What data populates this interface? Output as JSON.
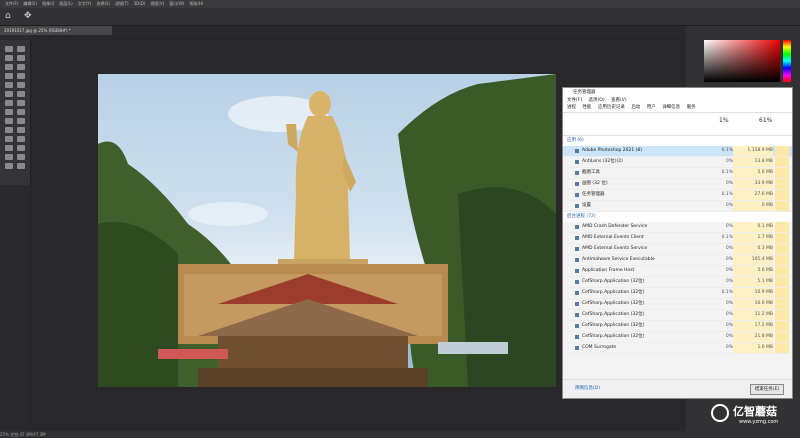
{
  "photoshop": {
    "menu": [
      "文件(F)",
      "编辑(E)",
      "图像(I)",
      "图层(L)",
      "文字(Y)",
      "选择(S)",
      "滤镜(T)",
      "3D(D)",
      "视图(V)",
      "窗口(W)",
      "帮助(H)"
    ],
    "doc_tab": "20191017.jpg @ 25% (RGB/8#) *",
    "status": "25% 文档:47.3M/47.3M"
  },
  "task_manager": {
    "title": "任务管理器",
    "menu": [
      "文件(F)",
      "选项(O)",
      "查看(V)"
    ],
    "tabs": [
      "进程",
      "性能",
      "应用历史记录",
      "启动",
      "用户",
      "详细信息",
      "服务"
    ],
    "cpu_header": "1%",
    "mem_header": "61%",
    "apps_section": "应用 (6)",
    "apps": [
      {
        "name": "Adobe Photoshop 2021 (8)",
        "cpu": "0.1%",
        "mem": "1,158.9 MB"
      },
      {
        "name": "AntiLens (32位)(2)",
        "cpu": "0%",
        "mem": "13.8 MB"
      },
      {
        "name": "截图工具",
        "cpu": "0.1%",
        "mem": "5.6 MB"
      },
      {
        "name": "画图 (32 位)",
        "cpu": "0%",
        "mem": "33.9 MB"
      },
      {
        "name": "任务管理器",
        "cpu": "0.1%",
        "mem": "27.6 MB"
      },
      {
        "name": "设置",
        "cpu": "0%",
        "mem": "0 MB"
      }
    ],
    "bg_section": "后台进程 (72)",
    "bg": [
      {
        "name": "AMD Crash Defender Service",
        "cpu": "0%",
        "mem": "0.1 MB"
      },
      {
        "name": "AMD External Events Client",
        "cpu": "0.1%",
        "mem": "1.7 MB"
      },
      {
        "name": "AMD External Events Service",
        "cpu": "0%",
        "mem": "0.3 MB"
      },
      {
        "name": "Antimalware Service Executable",
        "cpu": "0%",
        "mem": "105.4 MB"
      },
      {
        "name": "Application Frame Host",
        "cpu": "0%",
        "mem": "5.6 MB"
      },
      {
        "name": "CefSharp.Application (32位)",
        "cpu": "0%",
        "mem": "5.1 MB"
      },
      {
        "name": "CefSharp.Application (32位)",
        "cpu": "0.1%",
        "mem": "10.9 MB"
      },
      {
        "name": "CefSharp.Application (32位)",
        "cpu": "0%",
        "mem": "10.6 MB"
      },
      {
        "name": "CefSharp.Application (32位)",
        "cpu": "0%",
        "mem": "11.2 MB"
      },
      {
        "name": "CefSharp.Application (32位)",
        "cpu": "0%",
        "mem": "17.2 MB"
      },
      {
        "name": "CefSharp.Application (32位)",
        "cpu": "0%",
        "mem": "21.8 MB"
      },
      {
        "name": "COM Surrogate",
        "cpu": "0%",
        "mem": "1.6 MB"
      }
    ],
    "fewer": "简略信息(D)",
    "end_task": "结束任务(E)"
  },
  "watermark": {
    "text": "亿智蘑菇",
    "url": "www.yzmg.com"
  }
}
